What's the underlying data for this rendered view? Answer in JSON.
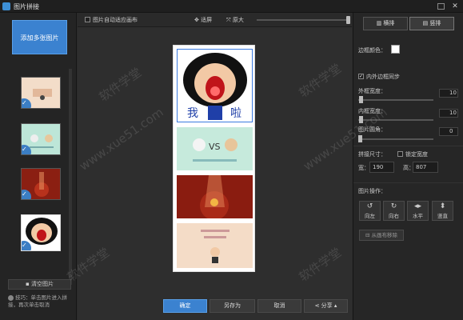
{
  "window": {
    "title": "图片拼接"
  },
  "left": {
    "add_label": "添加多张图片",
    "clear_label": "清空图片",
    "tip": "技巧：单击图片进入拼接，再次单击取消"
  },
  "toolbar": {
    "auto_fit_label": "图片自动适应画布",
    "fit_label": "适屏",
    "original_label": "原大"
  },
  "center_buttons": {
    "confirm": "确定",
    "save_as": "另存为",
    "cancel": "取消",
    "share": "分享"
  },
  "right": {
    "tab_horizontal": "横排",
    "tab_vertical": "竖排",
    "border_color_label": "边框颜色：",
    "border_color": "#ffffff",
    "sync_label": "内外边框同步",
    "outer_width_label": "外框宽度：",
    "outer_width_value": "10",
    "inner_width_label": "内框宽度：",
    "inner_width_value": "10",
    "corner_label": "图片圆角：",
    "corner_value": "0",
    "size_label": "拼接尺寸：",
    "lock_label": "锁定宽度",
    "width_label": "宽：",
    "width_value": "190",
    "height_label": "高：",
    "height_value": "807",
    "ops_label": "图片操作：",
    "op_left": "向左",
    "op_right": "向右",
    "op_hflip": "水平",
    "op_vflip": "竖直",
    "remove_label": "从画布移除"
  },
  "watermark": "软件学堂",
  "watermark_url": "www.xue51.com",
  "colors": {
    "accent": "#3b82d0",
    "background": "#2b2b2b"
  }
}
